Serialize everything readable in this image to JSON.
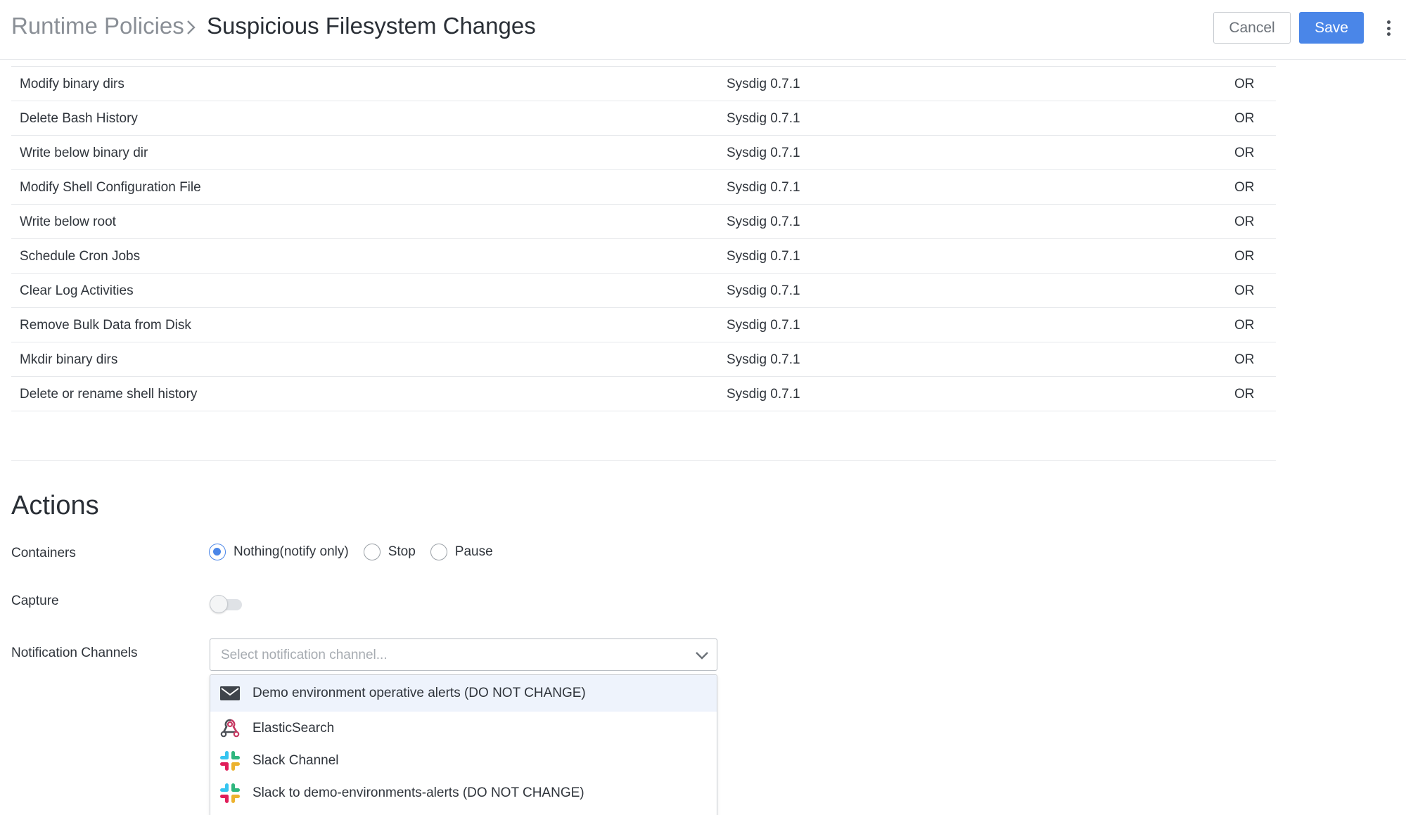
{
  "header": {
    "breadcrumb_parent": "Runtime Policies",
    "title": "Suspicious Filesystem Changes",
    "cancel_label": "Cancel",
    "save_label": "Save"
  },
  "rules": [
    {
      "name": "Modify binary dirs",
      "source": "Sysdig 0.7.1",
      "operator": "OR"
    },
    {
      "name": "Delete Bash History",
      "source": "Sysdig 0.7.1",
      "operator": "OR"
    },
    {
      "name": "Write below binary dir",
      "source": "Sysdig 0.7.1",
      "operator": "OR"
    },
    {
      "name": "Modify Shell Configuration File",
      "source": "Sysdig 0.7.1",
      "operator": "OR"
    },
    {
      "name": "Write below root",
      "source": "Sysdig 0.7.1",
      "operator": "OR"
    },
    {
      "name": "Schedule Cron Jobs",
      "source": "Sysdig 0.7.1",
      "operator": "OR"
    },
    {
      "name": "Clear Log Activities",
      "source": "Sysdig 0.7.1",
      "operator": "OR"
    },
    {
      "name": "Remove Bulk Data from Disk",
      "source": "Sysdig 0.7.1",
      "operator": "OR"
    },
    {
      "name": "Mkdir binary dirs",
      "source": "Sysdig 0.7.1",
      "operator": "OR"
    },
    {
      "name": "Delete or rename shell history",
      "source": "Sysdig 0.7.1",
      "operator": "OR"
    }
  ],
  "actions": {
    "title": "Actions",
    "containers": {
      "label": "Containers",
      "options": [
        "Nothing(notify only)",
        "Stop",
        "Pause"
      ],
      "selected": "Nothing(notify only)"
    },
    "capture": {
      "label": "Capture",
      "enabled": false
    },
    "notification_channels": {
      "label": "Notification Channels",
      "placeholder": "Select notification channel...",
      "options": [
        {
          "label": "Demo environment operative alerts (DO NOT CHANGE)",
          "icon": "email-icon",
          "highlighted": true
        },
        {
          "label": "ElasticSearch",
          "icon": "webhook-icon",
          "highlighted": false
        },
        {
          "label": "Slack Channel",
          "icon": "slack-icon",
          "highlighted": false
        },
        {
          "label": "Slack to demo-environments-alerts (DO NOT CHANGE)",
          "icon": "slack-icon",
          "highlighted": false
        }
      ]
    }
  },
  "colors": {
    "accent": "#4a86e8",
    "slack_blue": "#36c5f0",
    "slack_green": "#2eb67d",
    "slack_yellow": "#ecb22e",
    "slack_red": "#e01e5a",
    "webhook_red": "#c73a63"
  }
}
